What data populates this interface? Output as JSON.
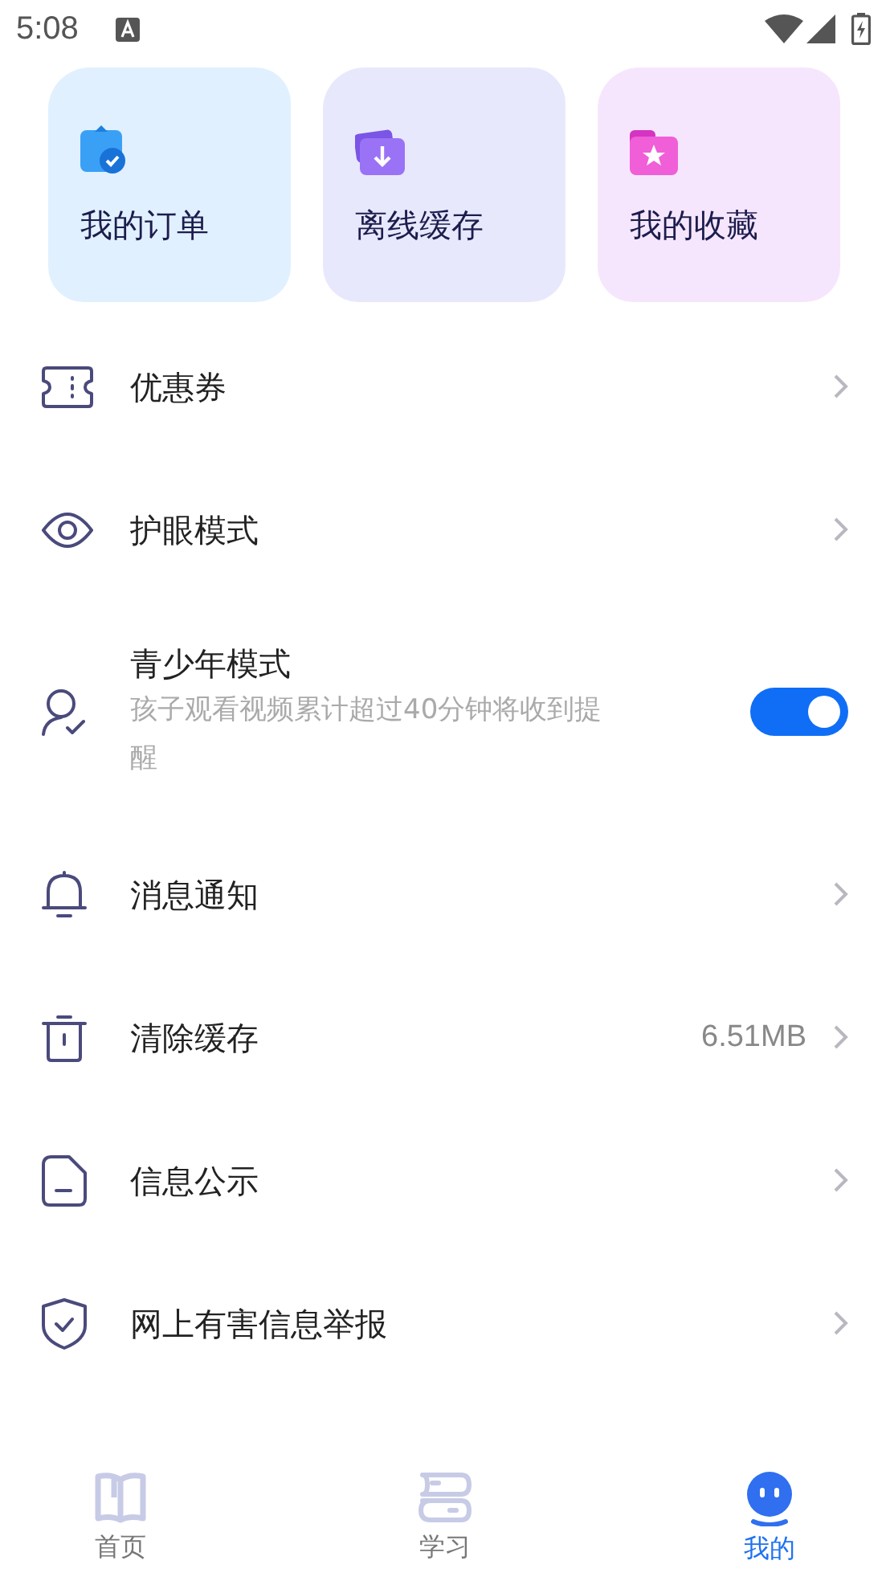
{
  "status_bar": {
    "time": "5:08"
  },
  "shortcuts": [
    {
      "label": "我的订单",
      "color": "#e1f0ff"
    },
    {
      "label": "离线缓存",
      "color": "#e8e8fd"
    },
    {
      "label": "我的收藏",
      "color": "#f6e6fd"
    }
  ],
  "menu": [
    {
      "kind": "link",
      "label": "优惠券"
    },
    {
      "kind": "link",
      "label": "护眼模式"
    },
    {
      "kind": "toggle",
      "label": "青少年模式",
      "description": "孩子观看视频累计超过40分钟将收到提醒",
      "on": true
    },
    {
      "kind": "link",
      "label": "消息通知"
    },
    {
      "kind": "link",
      "label": "清除缓存",
      "value": "6.51MB"
    },
    {
      "kind": "link",
      "label": "信息公示"
    },
    {
      "kind": "link",
      "label": "网上有害信息举报"
    }
  ],
  "bottom_nav": [
    {
      "label": "首页",
      "selected": false
    },
    {
      "label": "学习",
      "selected": false
    },
    {
      "label": "我的",
      "selected": true
    }
  ]
}
